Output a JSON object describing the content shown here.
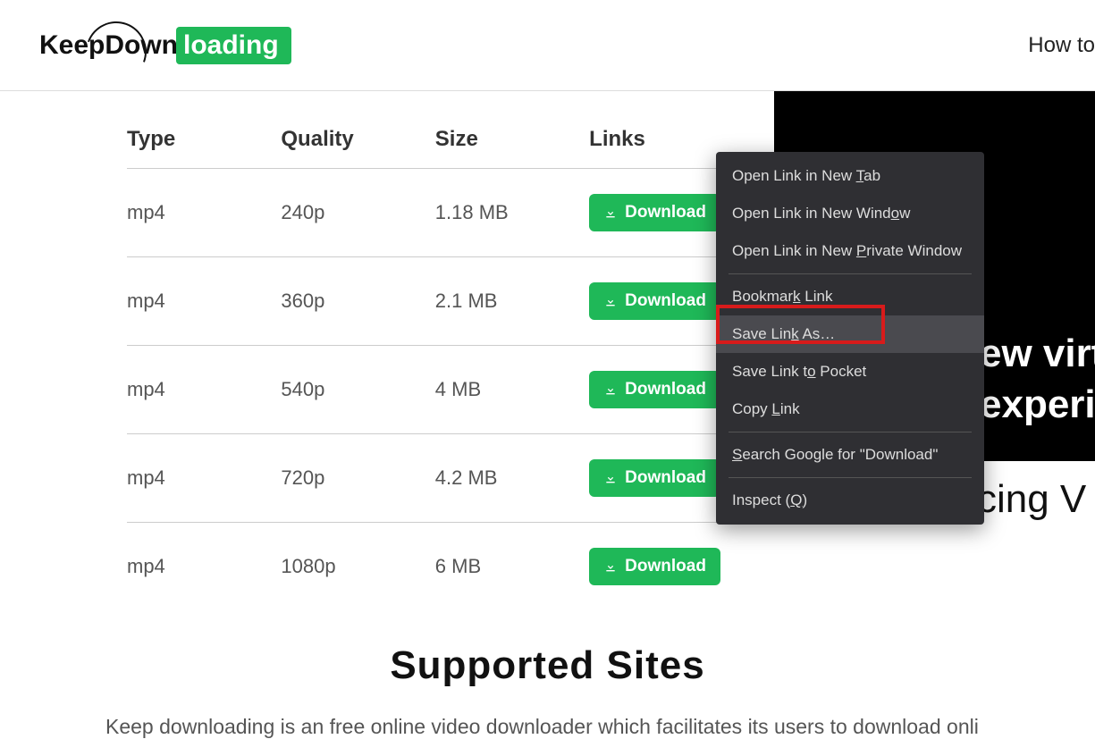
{
  "logo": {
    "part1": "Keep",
    "part2": "Down",
    "part3": "loading"
  },
  "nav": {
    "howto": "How to"
  },
  "table": {
    "headers": {
      "type": "Type",
      "quality": "Quality",
      "size": "Size",
      "links": "Links"
    },
    "rows": [
      {
        "type": "mp4",
        "quality": "240p",
        "size": "1.18 MB",
        "btn": "Download"
      },
      {
        "type": "mp4",
        "quality": "360p",
        "size": "2.1 MB",
        "btn": "Download"
      },
      {
        "type": "mp4",
        "quality": "540p",
        "size": "4 MB",
        "btn": "Download"
      },
      {
        "type": "mp4",
        "quality": "720p",
        "size": "4.2 MB",
        "btn": "Download"
      },
      {
        "type": "mp4",
        "quality": "1080p",
        "size": "6 MB",
        "btn": "Download"
      }
    ]
  },
  "video": {
    "line1": "ew virtua",
    "line2": "experien"
  },
  "intro": "Introducing V",
  "supported_title": "Supported Sites",
  "subtext": "Keep downloading is an free online video downloader which facilitates its users to download onli",
  "context_menu": {
    "items": [
      {
        "pre": "Open Link in New ",
        "u": "T",
        "post": "ab"
      },
      {
        "pre": "Open Link in New Wind",
        "u": "o",
        "post": "w"
      },
      {
        "pre": "Open Link in New ",
        "u": "P",
        "post": "rivate Window"
      }
    ],
    "bookmark": {
      "pre": "Bookmar",
      "u": "k",
      "post": " Link"
    },
    "savelink": {
      "pre": "Save Lin",
      "u": "k",
      "post": " As…"
    },
    "pocket": {
      "pre": "Save Link t",
      "u": "o",
      "post": " Pocket"
    },
    "copy": {
      "pre": "Copy ",
      "u": "L",
      "post": "ink"
    },
    "search": {
      "pre": "",
      "u": "S",
      "post": "earch Google for \"Download\""
    },
    "inspect": {
      "pre": "Inspect (",
      "u": "Q",
      "post": ")"
    }
  }
}
